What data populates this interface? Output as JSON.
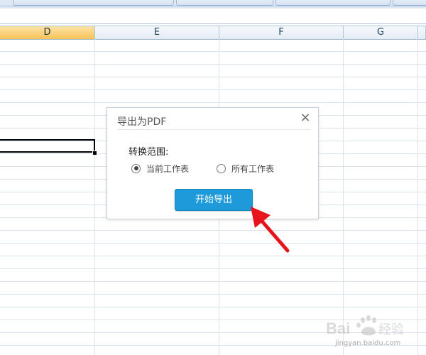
{
  "column_headers": [
    {
      "label": "D",
      "active": true
    },
    {
      "label": "E",
      "active": false
    },
    {
      "label": "F",
      "active": false
    },
    {
      "label": "G",
      "active": false
    }
  ],
  "dialog": {
    "title": "导出为PDF",
    "close_symbol": "×",
    "range_label": "转换范围:",
    "options": [
      {
        "label": "当前工作表",
        "checked": true
      },
      {
        "label": "所有工作表",
        "checked": false
      }
    ],
    "start_button": "开始导出"
  },
  "colors": {
    "accent_button": "#1d9ad9",
    "active_column_header": "#f6c45a",
    "annotation_arrow": "#e8141b"
  },
  "icons": {
    "dialog_close": "close-icon",
    "annotation": "red-arrow-icon"
  },
  "watermark": {
    "logo": "Baidu经验",
    "url": "jingyan.baidu.com"
  }
}
